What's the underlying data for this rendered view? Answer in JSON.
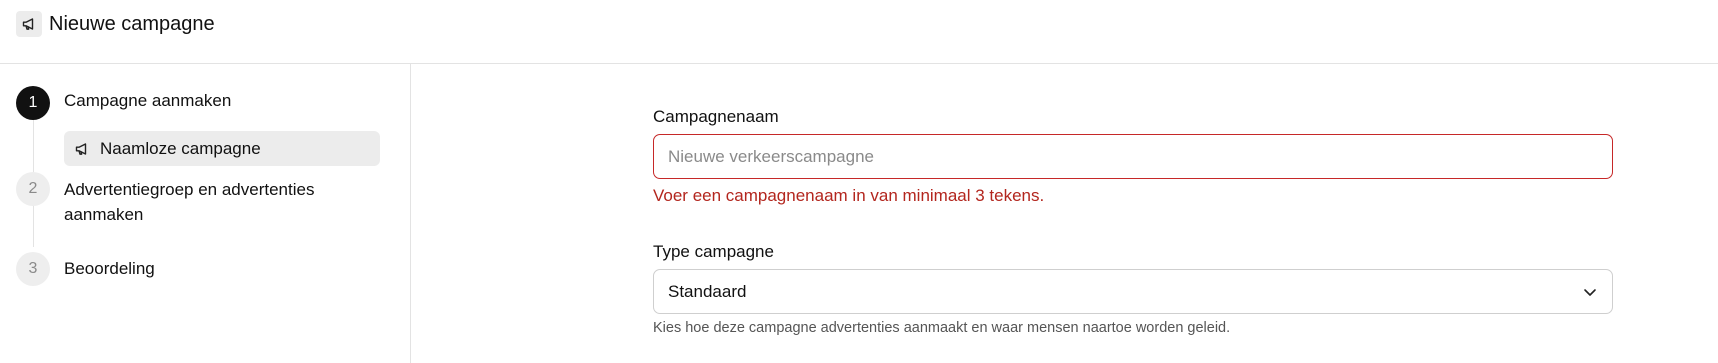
{
  "header": {
    "icon": "megaphone-icon",
    "title": "Nieuwe campagne"
  },
  "steps": [
    {
      "number": "1",
      "label": "Campagne aanmaken",
      "state": "active",
      "sub_items": [
        {
          "icon": "megaphone-icon",
          "label": "Naamloze campagne"
        }
      ]
    },
    {
      "number": "2",
      "label": "Advertentiegroep en advertenties aanmaken",
      "state": "inactive"
    },
    {
      "number": "3",
      "label": "Beoordeling",
      "state": "inactive"
    }
  ],
  "form": {
    "campaign_name": {
      "label": "Campagnenaam",
      "value": "",
      "placeholder": "Nieuwe verkeerscampagne",
      "error": "Voer een campagnenaam in van minimaal 3 tekens."
    },
    "campaign_type": {
      "label": "Type campagne",
      "value": "Standaard",
      "helper": "Kies hoe deze campagne advertenties aanmaakt en waar mensen naartoe worden geleid."
    }
  },
  "colors": {
    "error": "#b3261e",
    "active_step": "#111111",
    "inactive_step_bg": "#eeeeee",
    "selected_sub_item_bg": "#ececec"
  }
}
